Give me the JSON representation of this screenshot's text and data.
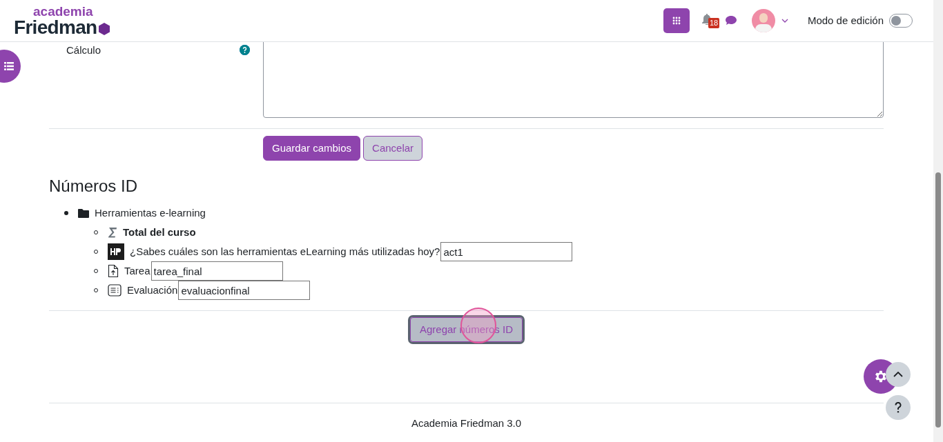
{
  "header": {
    "logo_top": "academia",
    "logo_bottom": "Friedman",
    "notifications_count": "18",
    "edit_mode": {
      "label": "Modo de edición",
      "on": false
    }
  },
  "form": {
    "field_label": "Cálculo",
    "buttons": [
      {
        "label": "Guardar cambios",
        "kind": "primary"
      },
      {
        "label": "Cancelar",
        "kind": "secondary"
      }
    ]
  },
  "id_numbers": {
    "title": "Números ID",
    "tree": [
      {
        "kind": "category",
        "label": "Herramientas e-learning",
        "children": [
          {
            "kind": "total",
            "label": "Total del curso"
          },
          {
            "kind": "h5p",
            "label": "¿Sabes cuáles son las herramientas eLearning más utilizadas hoy?",
            "value": "act1"
          },
          {
            "kind": "assignment",
            "label": "Tarea",
            "value": "tarea_final"
          },
          {
            "kind": "quiz",
            "label": "Evaluación",
            "value": "evaluacionfinal"
          }
        ]
      }
    ],
    "submit": "Agregar números ID"
  },
  "footer": {
    "text": "Academia Friedman 3.0"
  }
}
